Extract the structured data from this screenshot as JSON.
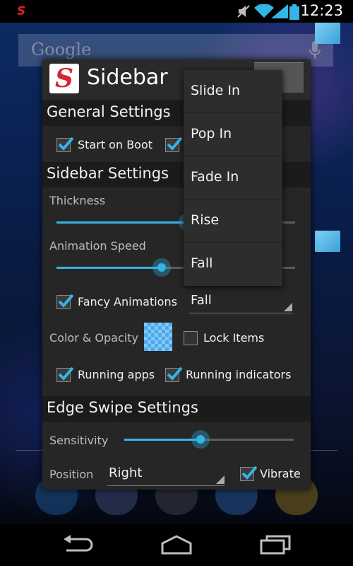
{
  "status_bar": {
    "time": "12:23",
    "icons": [
      "sidebar-app-icon",
      "mute-icon",
      "wifi-icon",
      "signal-icon",
      "battery-icon"
    ],
    "app_glyph": "S"
  },
  "home": {
    "search_placeholder": "Google",
    "search_icon": "mic-icon"
  },
  "dialog": {
    "title": "Sidebar",
    "logo_glyph": "S",
    "general": {
      "header": "General Settings",
      "start_on_boot": {
        "label": "Start on Boot",
        "checked": true
      }
    },
    "sidebar_settings": {
      "header": "Sidebar Settings",
      "thickness_label": "Thickness",
      "animation_speed_label": "Animation Speed",
      "fancy_animations": {
        "label": "Fancy Animations",
        "checked": true
      },
      "animation_value": "Fall",
      "color_opacity_label": "Color & Opacity",
      "lock_items": {
        "label": "Lock Items",
        "checked": false
      },
      "running_apps": {
        "label": "Running apps",
        "checked": true
      },
      "running_indicators": {
        "label": "Running indicators",
        "checked": true
      }
    },
    "edge_swipe": {
      "header": "Edge Swipe Settings",
      "sensitivity_label": "Sensitivity",
      "position_label": "Position",
      "position_value": "Right",
      "vibrate": {
        "label": "Vibrate",
        "checked": true
      }
    }
  },
  "sliders": {
    "thickness": 0.55,
    "animation_speed": 0.44,
    "sensitivity": 0.45
  },
  "dropdown_options": [
    "Slide In",
    "Pop In",
    "Fade In",
    "Rise",
    "Fall"
  ],
  "colors": {
    "accent": "#34b5e5",
    "panel": "#262626",
    "section_header": "#1b1b1b",
    "logo_red": "#d6262e"
  }
}
